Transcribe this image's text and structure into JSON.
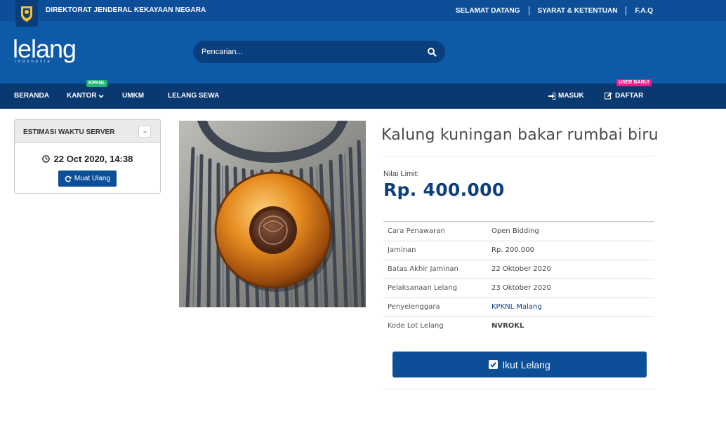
{
  "topbar": {
    "org_name": "DIREKTORAT JENDERAL KEKAYAAN NEGARA",
    "links": [
      "SELAMAT DATANG",
      "SYARAT & KETENTUAN",
      "F.A.Q"
    ]
  },
  "logo": {
    "word": "lelang",
    "sub": "indonesia"
  },
  "search": {
    "placeholder": "Pencarian..."
  },
  "nav": {
    "items": [
      "BERANDA",
      "KANTOR",
      "UMKM",
      "LELANG SEWA"
    ],
    "kantor_badge": "KPKNL",
    "login": "MASUK",
    "register": "DAFTAR",
    "register_badge": "USER BARU!"
  },
  "widget": {
    "title": "ESTIMASI WAKTU SERVER",
    "datetime": "22 Oct 2020, 14:38",
    "reload": "Muat Ulang"
  },
  "product": {
    "title": "Kalung kuningan bakar rumbai biru",
    "limit_label": "Nilai Limit:",
    "limit_value": "Rp. 400.000",
    "details": [
      {
        "label": "Cara Penawaran",
        "value": "Open Bidding"
      },
      {
        "label": "Jaminan",
        "value": "Rp. 200.000"
      },
      {
        "label": "Batas Akhir Jaminan",
        "value": "22 Oktober 2020"
      },
      {
        "label": "Pelaksanaan Lelang",
        "value": "23 Oktober 2020"
      },
      {
        "label": "Penyelenggara",
        "value": "KPKNL Malang"
      },
      {
        "label": "Kode Lot Lelang",
        "value": "NVROKL"
      }
    ],
    "bid_button": "Ikut Lelang"
  },
  "colors": {
    "topbar": "#0c4f98",
    "header": "#0c5aa8",
    "nav": "#0a3870",
    "accent": "#0c4f98",
    "price": "#0c3f7e"
  }
}
